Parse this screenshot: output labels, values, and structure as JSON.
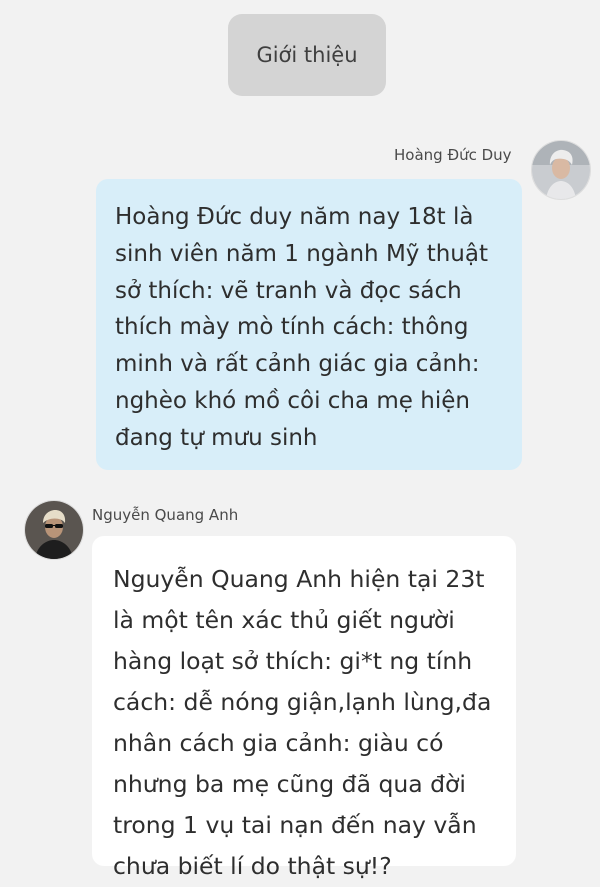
{
  "header": {
    "intro_label": "Giới thiệu"
  },
  "messages": [
    {
      "side": "right",
      "sender": "Hoàng Đức Duy",
      "avatar_icon": "profile-avatar-young-man",
      "bubble_color": "#d8eef9",
      "lines": [
        "Hoàng Đức duy năm nay 18t là",
        "sinh viên năm 1 ngành Mỹ thuật",
        "sở thích: vẽ tranh và đọc sách",
        "thích mày mò tính cách: thông",
        "minh và rất cảnh giác gia cảnh:",
        "nghèo khó mồ côi cha mẹ hiện",
        "đang tự mưu sinh"
      ]
    },
    {
      "side": "left",
      "sender": "Nguyễn Quang Anh",
      "avatar_icon": "profile-avatar-man-sunglasses",
      "bubble_color": "#ffffff",
      "lines": [
        "Nguyễn Quang Anh hiện tại 23t",
        "là một tên xác thủ giết người",
        "hàng loạt sở thích: gi*t ng tính",
        "cách: dễ nóng giận,lạnh lùng,đa",
        "nhân cách gia cảnh: giàu có",
        "nhưng ba mẹ cũng đã qua đời",
        "trong 1 vụ tai nạn đến nay vẫn",
        "chưa biết lí do thật sự!?"
      ]
    }
  ],
  "colors": {
    "background": "#f2f2f2",
    "pill": "#d4d4d4",
    "text": "#2e2e2e"
  }
}
